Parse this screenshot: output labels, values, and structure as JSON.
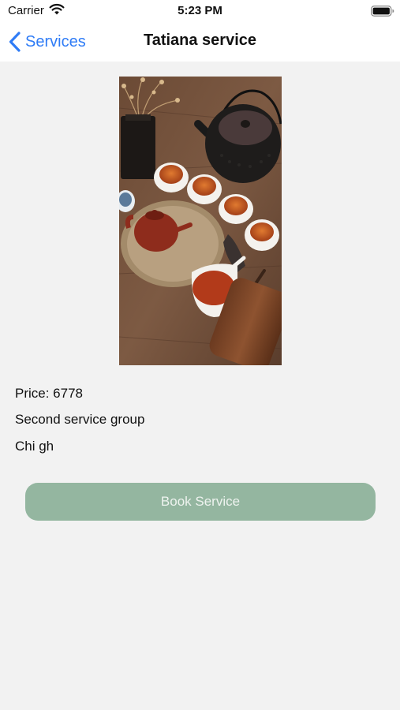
{
  "status_bar": {
    "carrier": "Carrier",
    "time": "5:23 PM",
    "wifi_icon": "wifi-icon",
    "battery_icon": "battery-icon"
  },
  "nav": {
    "back_label": "Services",
    "back_icon": "chevron-left-icon",
    "title": "Tatiana service",
    "accent_color": "#2f7cf6"
  },
  "service": {
    "image_icon": "tea-set-photo",
    "price_line": "Price: 6778",
    "group": "Second service group",
    "description": "Chi gh"
  },
  "actions": {
    "book_label": "Book Service",
    "book_color": "#94b6a0"
  }
}
